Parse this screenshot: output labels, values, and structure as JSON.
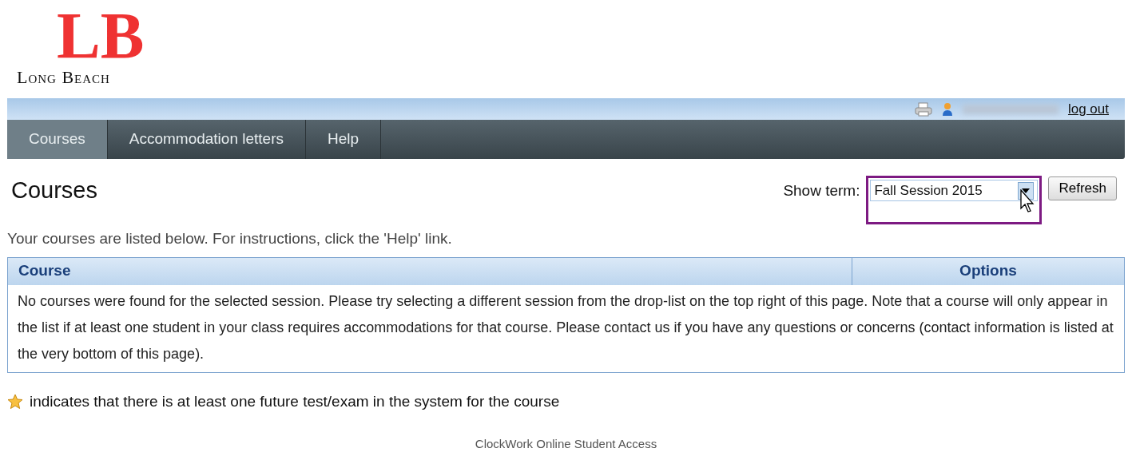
{
  "logo": {
    "monogram": "LB",
    "name": "Long Beach"
  },
  "top_bar": {
    "logout": "log out"
  },
  "nav": [
    {
      "label": "Courses",
      "selected": true
    },
    {
      "label": "Accommodation letters",
      "selected": false
    },
    {
      "label": "Help",
      "selected": false
    }
  ],
  "page_title": "Courses",
  "term": {
    "label": "Show term:",
    "value": "Fall Session 2015",
    "button": "Refresh",
    "highlighted": true
  },
  "intro": "Your courses are listed below. For instructions, click the 'Help' link.",
  "table": {
    "columns": [
      "Course",
      "Options"
    ],
    "empty_message": "No courses were found for the selected session. Please try selecting a different session from the drop-list on the top right of this page. Note that a course will only appear in the list if at least one student in your class requires accommodations for that course. Please contact us if you have any questions or concerns (contact information is listed at the very bottom of this page)."
  },
  "legend": "indicates that there is at least one future test/exam in the system for the course",
  "footer": "ClockWork Online Student Access"
}
